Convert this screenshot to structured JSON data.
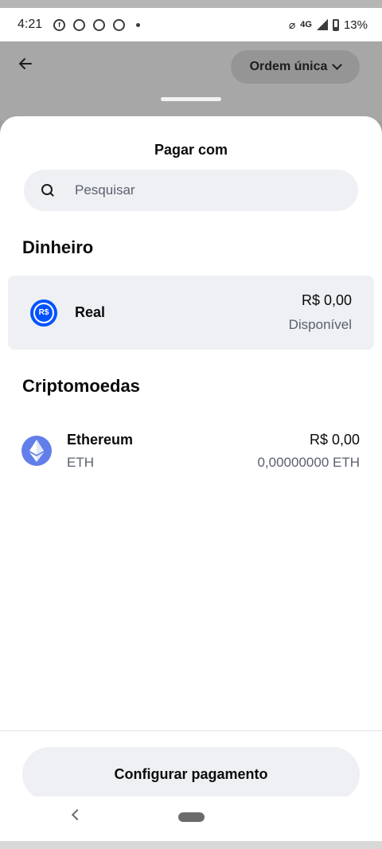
{
  "status_bar": {
    "time": "4:21",
    "network": "4G",
    "battery": "13%",
    "icons": [
      "facebook-icon",
      "whatsapp-icon",
      "chrome-icon",
      "chrome-icon",
      "dot-icon",
      "bell-off-icon",
      "signal-icon",
      "battery-icon"
    ]
  },
  "header": {
    "order_type_label": "Ordem única"
  },
  "sheet": {
    "title": "Pagar com",
    "search_placeholder": "Pesquisar"
  },
  "sections": {
    "cash": {
      "title": "Dinheiro",
      "items": [
        {
          "name": "Real",
          "logo_text": "R$",
          "value": "R$ 0,00",
          "subtext": "Disponível"
        }
      ]
    },
    "crypto": {
      "title": "Criptomoedas",
      "items": [
        {
          "name": "Ethereum",
          "ticker": "ETH",
          "value": "R$ 0,00",
          "amount": "0,00000000 ETH"
        }
      ]
    }
  },
  "footer": {
    "button_label": "Configurar pagamento"
  },
  "colors": {
    "brand_blue": "#0052ff",
    "eth_purple": "#627eea",
    "muted_text": "#5b616e",
    "surface_gray": "#eef0f3"
  }
}
